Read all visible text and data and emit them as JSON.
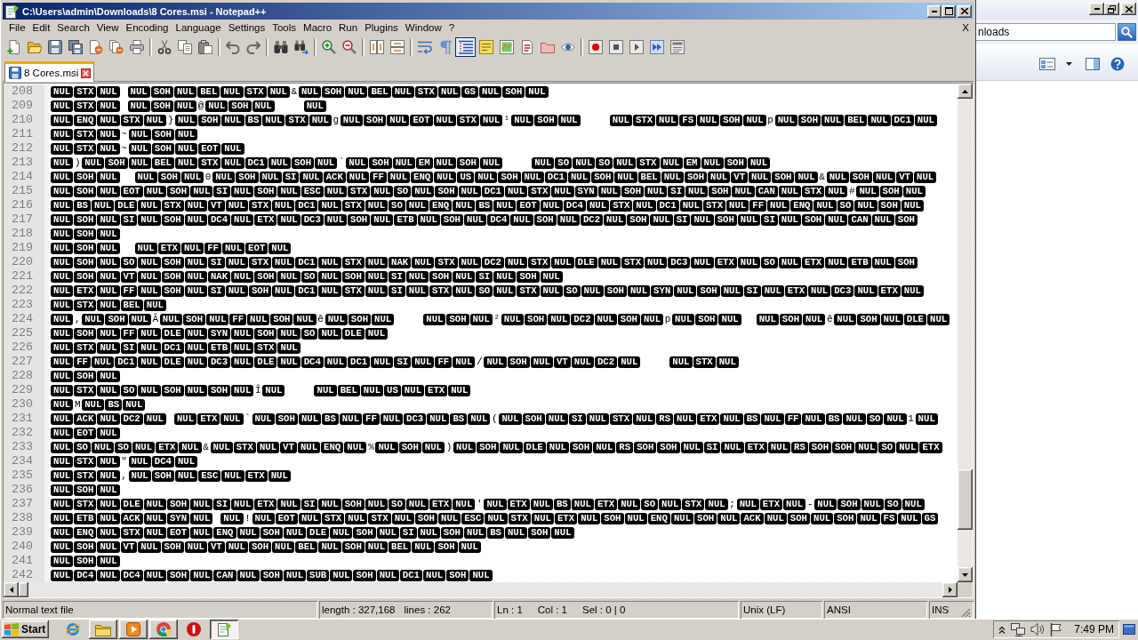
{
  "window": {
    "title": "C:\\Users\\admin\\Downloads\\8 Cores.msi - Notepad++"
  },
  "menu": {
    "items": [
      "File",
      "Edit",
      "Search",
      "View",
      "Encoding",
      "Language",
      "Settings",
      "Tools",
      "Macro",
      "Run",
      "Plugins",
      "Window",
      "?"
    ],
    "close_button": "X"
  },
  "toolbar": [
    {
      "selected": false
    },
    {
      "selected": false
    },
    {
      "selected": false
    },
    {
      "selected": false
    },
    {
      "selected": false
    },
    {
      "selected": false
    },
    {
      "selected": false
    },
    {
      "selected": false
    },
    {
      "selected": false
    },
    {
      "selected": false
    },
    {
      "selected": false
    },
    {
      "selected": false
    },
    {
      "selected": false
    },
    {
      "selected": false
    },
    {
      "selected": false
    },
    {
      "selected": false
    },
    {
      "selected": false
    },
    {
      "selected": false
    },
    {
      "selected": false
    },
    {
      "selected": false
    },
    {
      "selected": true
    },
    {
      "selected": false
    },
    {
      "selected": false
    },
    {
      "selected": false
    },
    {
      "selected": false
    },
    {
      "selected": false
    },
    {
      "selected": false
    },
    {
      "selected": false
    },
    {
      "selected": false
    },
    {
      "selected": false
    },
    {
      "selected": false
    }
  ],
  "tabs": [
    {
      "label": "8 Cores.msi",
      "selected": true
    }
  ],
  "editor": {
    "lines": [
      {
        "number": "208",
        "runs": [
          {
            "kind": "ctrl",
            "codes": [
              "NUL",
              "STX",
              "NUL"
            ]
          },
          {
            "kind": "space"
          },
          {
            "kind": "ctrl",
            "codes": [
              "NUL",
              "SOH",
              "NUL",
              "BEL",
              "NUL",
              "STX",
              "NUL"
            ]
          },
          {
            "kind": "text",
            "text": "&"
          },
          {
            "kind": "ctrl",
            "codes": [
              "NUL",
              "SOH",
              "NUL",
              "BEL",
              "NUL",
              "STX",
              "NUL",
              "GS",
              "NUL",
              "SOH",
              "NUL"
            ]
          }
        ]
      },
      {
        "number": "209",
        "runs": [
          {
            "kind": "ctrl",
            "codes": [
              "NUL",
              "STX",
              "NUL"
            ]
          },
          {
            "kind": "space"
          },
          {
            "kind": "ctrl",
            "codes": [
              "NUL",
              "SOH",
              "NUL"
            ]
          },
          {
            "kind": "text",
            "text": "@"
          },
          {
            "kind": "ctrl",
            "codes": [
              "NUL",
              "SOH",
              "NUL"
            ]
          },
          {
            "kind": "tab"
          },
          {
            "kind": "ctrl",
            "codes": [
              "NUL"
            ]
          }
        ]
      },
      {
        "number": "210",
        "runs": [
          {
            "kind": "ctrl",
            "codes": [
              "NUL",
              "ENQ",
              "NUL",
              "STX",
              "NUL"
            ]
          },
          {
            "kind": "text",
            "text": "}"
          },
          {
            "kind": "ctrl",
            "codes": [
              "NUL",
              "SOH",
              "NUL",
              "BS",
              "NUL",
              "STX",
              "NUL"
            ]
          },
          {
            "kind": "text",
            "text": "g"
          },
          {
            "kind": "ctrl",
            "codes": [
              "NUL",
              "SOH",
              "NUL",
              "EOT",
              "NUL",
              "STX",
              "NUL"
            ]
          },
          {
            "kind": "text",
            "text": "¹"
          },
          {
            "kind": "ctrl",
            "codes": [
              "NUL",
              "SOH",
              "NUL"
            ]
          },
          {
            "kind": "tab"
          },
          {
            "kind": "ctrl",
            "codes": [
              "NUL",
              "STX",
              "NUL",
              "FS",
              "NUL",
              "SOH",
              "NUL"
            ]
          },
          {
            "kind": "text",
            "text": "p"
          },
          {
            "kind": "ctrl",
            "codes": [
              "NUL",
              "SOH",
              "NUL",
              "BEL",
              "NUL",
              "DC1",
              "NUL"
            ]
          }
        ]
      },
      {
        "number": "211",
        "runs": [
          {
            "kind": "ctrl",
            "codes": [
              "NUL",
              "STX",
              "NUL"
            ]
          },
          {
            "kind": "text",
            "text": "~"
          },
          {
            "kind": "ctrl",
            "codes": [
              "NUL",
              "SOH",
              "NUL"
            ]
          }
        ]
      },
      {
        "number": "212",
        "runs": [
          {
            "kind": "ctrl",
            "codes": [
              "NUL",
              "STX",
              "NUL"
            ]
          },
          {
            "kind": "text",
            "text": "~"
          },
          {
            "kind": "ctrl",
            "codes": [
              "NUL",
              "SOH",
              "NUL",
              "EOT",
              "NUL"
            ]
          }
        ]
      },
      {
        "number": "213",
        "runs": [
          {
            "kind": "ctrl",
            "codes": [
              "NUL"
            ]
          },
          {
            "kind": "text",
            "text": ")"
          },
          {
            "kind": "ctrl",
            "codes": [
              "NUL",
              "SOH",
              "NUL",
              "BEL",
              "NUL",
              "STX",
              "NUL",
              "DC1",
              "NUL",
              "SOH",
              "NUL"
            ]
          },
          {
            "kind": "text",
            "text": "`"
          },
          {
            "kind": "ctrl",
            "codes": [
              "NUL",
              "SOH",
              "NUL",
              "EM",
              "NUL",
              "SOH",
              "NUL"
            ]
          },
          {
            "kind": "tab"
          },
          {
            "kind": "ctrl",
            "codes": [
              "NUL",
              "SO",
              "NUL",
              "SO",
              "NUL",
              "STX",
              "NUL",
              "EM",
              "NUL",
              "SOH",
              "NUL"
            ]
          }
        ]
      },
      {
        "number": "214",
        "runs": [
          {
            "kind": "ctrl",
            "codes": [
              "NUL",
              "SOH",
              "NUL"
            ]
          },
          {
            "kind": "space"
          },
          {
            "kind": "space"
          },
          {
            "kind": "ctrl",
            "codes": [
              "NUL",
              "SOH",
              "NUL"
            ]
          },
          {
            "kind": "text",
            "text": "0"
          },
          {
            "kind": "ctrl",
            "codes": [
              "NUL",
              "SOH",
              "NUL",
              "SI",
              "NUL",
              "ACK",
              "NUL",
              "FF",
              "NUL",
              "ENQ",
              "NUL",
              "US",
              "NUL",
              "SOH",
              "NUL",
              "DC1",
              "NUL",
              "SOH",
              "NUL",
              "BEL",
              "NUL",
              "SOH",
              "NUL",
              "VT",
              "NUL",
              "SOH",
              "NUL"
            ]
          },
          {
            "kind": "text",
            "text": "&"
          },
          {
            "kind": "ctrl",
            "codes": [
              "NUL",
              "SOH",
              "NUL",
              "VT",
              "NUL"
            ]
          }
        ]
      },
      {
        "number": "215",
        "runs": [
          {
            "kind": "ctrl",
            "codes": [
              "NUL",
              "SOH",
              "NUL",
              "EOT",
              "NUL",
              "SOH",
              "NUL",
              "SI",
              "NUL",
              "SOH",
              "NUL",
              "ESC",
              "NUL",
              "STX",
              "NUL",
              "SO",
              "NUL",
              "SOH",
              "NUL",
              "DC1",
              "NUL",
              "STX",
              "NUL",
              "SYN",
              "NUL",
              "SOH",
              "NUL",
              "SI",
              "NUL",
              "SOH",
              "NUL",
              "CAN",
              "NUL",
              "STX",
              "NUL"
            ]
          },
          {
            "kind": "text",
            "text": "#"
          },
          {
            "kind": "ctrl",
            "codes": [
              "NUL",
              "SOH",
              "NUL"
            ]
          }
        ]
      },
      {
        "number": "216",
        "runs": [
          {
            "kind": "ctrl",
            "codes": [
              "NUL",
              "BS",
              "NUL",
              "DLE",
              "NUL",
              "STX",
              "NUL",
              "VT",
              "NUL",
              "STX",
              "NUL",
              "DC1",
              "NUL",
              "STX",
              "NUL",
              "SO",
              "NUL",
              "ENQ",
              "NUL",
              "BS",
              "NUL",
              "EOT",
              "NUL",
              "DC4",
              "NUL",
              "STX",
              "NUL",
              "DC1",
              "NUL",
              "STX",
              "NUL",
              "FF",
              "NUL",
              "ENQ",
              "NUL",
              "SO",
              "NUL",
              "SOH",
              "NUL"
            ]
          }
        ]
      },
      {
        "number": "217",
        "runs": [
          {
            "kind": "ctrl",
            "codes": [
              "NUL",
              "SOH",
              "NUL",
              "SI",
              "NUL",
              "SOH",
              "NUL",
              "DC4",
              "NUL",
              "ETX",
              "NUL",
              "DC3",
              "NUL",
              "SOH",
              "NUL",
              "ETB",
              "NUL",
              "SOH",
              "NUL",
              "DC4",
              "NUL",
              "SOH",
              "NUL",
              "DC2",
              "NUL",
              "SOH",
              "NUL",
              "SI",
              "NUL",
              "SOH",
              "NUL",
              "SI",
              "NUL",
              "SOH",
              "NUL",
              "CAN",
              "NUL",
              "SOH"
            ]
          }
        ]
      },
      {
        "number": "218",
        "runs": [
          {
            "kind": "ctrl",
            "codes": [
              "NUL",
              "SOH",
              "NUL"
            ]
          }
        ]
      },
      {
        "number": "219",
        "runs": [
          {
            "kind": "ctrl",
            "codes": [
              "NUL",
              "SOH",
              "NUL"
            ]
          },
          {
            "kind": "space"
          },
          {
            "kind": "space"
          },
          {
            "kind": "ctrl",
            "codes": [
              "NUL",
              "ETX",
              "NUL",
              "FF",
              "NUL",
              "EOT",
              "NUL"
            ]
          }
        ]
      },
      {
        "number": "220",
        "runs": [
          {
            "kind": "ctrl",
            "codes": [
              "NUL",
              "SOH",
              "NUL",
              "SO",
              "NUL",
              "SOH",
              "NUL",
              "SI",
              "NUL",
              "STX",
              "NUL",
              "DC1",
              "NUL",
              "STX",
              "NUL",
              "NAK",
              "NUL",
              "STX",
              "NUL",
              "DC2",
              "NUL",
              "STX",
              "NUL",
              "DLE",
              "NUL",
              "STX",
              "NUL",
              "DC3",
              "NUL",
              "ETX",
              "NUL",
              "SO",
              "NUL",
              "ETX",
              "NUL",
              "ETB",
              "NUL",
              "SOH"
            ]
          }
        ]
      },
      {
        "number": "221",
        "runs": [
          {
            "kind": "ctrl",
            "codes": [
              "NUL",
              "SOH",
              "NUL",
              "VT",
              "NUL",
              "SOH",
              "NUL",
              "NAK",
              "NUL",
              "SOH",
              "NUL",
              "SO",
              "NUL",
              "SOH",
              "NUL",
              "SI",
              "NUL",
              "SOH",
              "NUL",
              "SI",
              "NUL",
              "SOH",
              "NUL"
            ]
          }
        ]
      },
      {
        "number": "222",
        "runs": [
          {
            "kind": "ctrl",
            "codes": [
              "NUL",
              "ETX",
              "NUL",
              "FF",
              "NUL",
              "SOH",
              "NUL",
              "SI",
              "NUL",
              "SOH",
              "NUL",
              "DC1",
              "NUL",
              "STX",
              "NUL",
              "SI",
              "NUL",
              "STX",
              "NUL",
              "SO",
              "NUL",
              "STX",
              "NUL",
              "SO",
              "NUL",
              "SOH",
              "NUL",
              "SYN",
              "NUL",
              "SOH",
              "NUL",
              "SI",
              "NUL",
              "ETX",
              "NUL",
              "DC3",
              "NUL",
              "ETX",
              "NUL"
            ]
          }
        ]
      },
      {
        "number": "223",
        "runs": [
          {
            "kind": "ctrl",
            "codes": [
              "NUL",
              "STX",
              "NUL",
              "BEL",
              "NUL"
            ]
          }
        ]
      },
      {
        "number": "224",
        "runs": [
          {
            "kind": "ctrl",
            "codes": [
              "NUL"
            ]
          },
          {
            "kind": "text",
            "text": ","
          },
          {
            "kind": "ctrl",
            "codes": [
              "NUL",
              "SOH",
              "NUL"
            ]
          },
          {
            "kind": "text",
            "text": "Â"
          },
          {
            "kind": "ctrl",
            "codes": [
              "NUL",
              "SOH",
              "NUL",
              "FF",
              "NUL",
              "SOH",
              "NUL"
            ]
          },
          {
            "kind": "text",
            "text": "ê"
          },
          {
            "kind": "ctrl",
            "codes": [
              "NUL",
              "SOH",
              "NUL"
            ]
          },
          {
            "kind": "tab"
          },
          {
            "kind": "ctrl",
            "codes": [
              "NUL",
              "SOH",
              "NUL"
            ]
          },
          {
            "kind": "text",
            "text": "²"
          },
          {
            "kind": "ctrl",
            "codes": [
              "NUL",
              "SOH",
              "NUL",
              "DC2",
              "NUL",
              "SOH",
              "NUL"
            ]
          },
          {
            "kind": "text",
            "text": "p"
          },
          {
            "kind": "ctrl",
            "codes": [
              "NUL",
              "SOH",
              "NUL"
            ]
          },
          {
            "kind": "space"
          },
          {
            "kind": "space"
          },
          {
            "kind": "ctrl",
            "codes": [
              "NUL",
              "SOH",
              "NUL"
            ]
          },
          {
            "kind": "text",
            "text": "ê"
          },
          {
            "kind": "ctrl",
            "codes": [
              "NUL",
              "SOH",
              "NUL",
              "DLE",
              "NUL"
            ]
          }
        ]
      },
      {
        "number": "225",
        "runs": [
          {
            "kind": "ctrl",
            "codes": [
              "NUL",
              "SOH",
              "NUL",
              "FF",
              "NUL",
              "DLE",
              "NUL",
              "SYN",
              "NUL",
              "SOH",
              "NUL",
              "SO",
              "NUL",
              "DLE",
              "NUL"
            ]
          }
        ]
      },
      {
        "number": "226",
        "runs": [
          {
            "kind": "ctrl",
            "codes": [
              "NUL",
              "STX",
              "NUL",
              "SI",
              "NUL",
              "DC1",
              "NUL",
              "ETB",
              "NUL",
              "STX",
              "NUL"
            ]
          }
        ]
      },
      {
        "number": "227",
        "runs": [
          {
            "kind": "ctrl",
            "codes": [
              "NUL",
              "FF",
              "NUL",
              "DC1",
              "NUL",
              "DLE",
              "NUL",
              "DC3",
              "NUL",
              "DLE",
              "NUL",
              "DC4",
              "NUL",
              "DC1",
              "NUL",
              "SI",
              "NUL",
              "FF",
              "NUL"
            ]
          },
          {
            "kind": "text",
            "text": "/"
          },
          {
            "kind": "ctrl",
            "codes": [
              "NUL",
              "SOH",
              "NUL",
              "VT",
              "NUL",
              "DC2",
              "NUL"
            ]
          },
          {
            "kind": "tab"
          },
          {
            "kind": "ctrl",
            "codes": [
              "NUL",
              "STX",
              "NUL"
            ]
          }
        ]
      },
      {
        "number": "228",
        "runs": [
          {
            "kind": "ctrl",
            "codes": [
              "NUL",
              "SOH",
              "NUL"
            ]
          }
        ]
      },
      {
        "number": "229",
        "runs": [
          {
            "kind": "ctrl",
            "codes": [
              "NUL",
              "STX",
              "NUL",
              "SO",
              "NUL",
              "SOH",
              "NUL",
              "SOH",
              "NUL"
            ]
          },
          {
            "kind": "text",
            "text": "Î"
          },
          {
            "kind": "ctrl",
            "codes": [
              "NUL"
            ]
          },
          {
            "kind": "tab"
          },
          {
            "kind": "ctrl",
            "codes": [
              "NUL",
              "BEL",
              "NUL",
              "US",
              "NUL",
              "ETX",
              "NUL"
            ]
          }
        ]
      },
      {
        "number": "230",
        "runs": [
          {
            "kind": "ctrl",
            "codes": [
              "NUL"
            ]
          },
          {
            "kind": "text",
            "text": "M"
          },
          {
            "kind": "ctrl",
            "codes": [
              "NUL",
              "BS",
              "NUL"
            ]
          }
        ]
      },
      {
        "number": "231",
        "runs": [
          {
            "kind": "ctrl",
            "codes": [
              "NUL",
              "ACK",
              "NUL",
              "DC2",
              "NUL"
            ]
          },
          {
            "kind": "space"
          },
          {
            "kind": "ctrl",
            "codes": [
              "NUL",
              "ETX",
              "NUL"
            ]
          },
          {
            "kind": "text",
            "text": "`"
          },
          {
            "kind": "ctrl",
            "codes": [
              "NUL",
              "SOH",
              "NUL",
              "BS",
              "NUL",
              "FF",
              "NUL",
              "DC3",
              "NUL",
              "BS",
              "NUL"
            ]
          },
          {
            "kind": "text",
            "text": "("
          },
          {
            "kind": "ctrl",
            "codes": [
              "NUL",
              "SOH",
              "NUL",
              "SI",
              "NUL",
              "STX",
              "NUL",
              "RS",
              "NUL",
              "ETX",
              "NUL",
              "BS",
              "NUL",
              "FF",
              "NUL",
              "BS",
              "NUL",
              "SO",
              "NUL"
            ]
          },
          {
            "kind": "text",
            "text": "1"
          },
          {
            "kind": "ctrl",
            "codes": [
              "NUL"
            ]
          }
        ]
      },
      {
        "number": "232",
        "runs": [
          {
            "kind": "ctrl",
            "codes": [
              "NUL",
              "EOT",
              "NUL"
            ]
          }
        ]
      },
      {
        "number": "233",
        "runs": [
          {
            "kind": "ctrl",
            "codes": [
              "NUL",
              "SO",
              "NUL",
              "SO",
              "NUL",
              "ETX",
              "NUL"
            ]
          },
          {
            "kind": "text",
            "text": "&"
          },
          {
            "kind": "ctrl",
            "codes": [
              "NUL",
              "STX",
              "NUL",
              "VT",
              "NUL",
              "ENQ",
              "NUL"
            ]
          },
          {
            "kind": "text",
            "text": "%"
          },
          {
            "kind": "ctrl",
            "codes": [
              "NUL",
              "SOH",
              "NUL"
            ]
          },
          {
            "kind": "text",
            "text": ")"
          },
          {
            "kind": "ctrl",
            "codes": [
              "NUL",
              "SOH",
              "NUL",
              "DLE",
              "NUL",
              "SOH",
              "NUL",
              "RS",
              "SOH",
              "SOH",
              "NUL",
              "SI",
              "NUL",
              "ETX",
              "NUL",
              "RS",
              "SOH",
              "SOH",
              "NUL",
              "SO",
              "NUL",
              "ETX"
            ]
          }
        ]
      },
      {
        "number": "234",
        "runs": [
          {
            "kind": "ctrl",
            "codes": [
              "NUL",
              "STX",
              "NUL"
            ]
          },
          {
            "kind": "text",
            "text": "\""
          },
          {
            "kind": "ctrl",
            "codes": [
              "NUL",
              "DC4",
              "NUL"
            ]
          }
        ]
      },
      {
        "number": "235",
        "runs": [
          {
            "kind": "ctrl",
            "codes": [
              "NUL",
              "STX",
              "NUL"
            ]
          },
          {
            "kind": "text",
            "text": ","
          },
          {
            "kind": "ctrl",
            "codes": [
              "NUL",
              "SOH",
              "NUL",
              "ESC",
              "NUL",
              "ETX",
              "NUL"
            ]
          }
        ]
      },
      {
        "number": "236",
        "runs": [
          {
            "kind": "ctrl",
            "codes": [
              "NUL",
              "SOH",
              "NUL"
            ]
          }
        ]
      },
      {
        "number": "237",
        "runs": [
          {
            "kind": "ctrl",
            "codes": [
              "NUL",
              "STX",
              "NUL",
              "DLE",
              "NUL",
              "SOH",
              "NUL",
              "SI",
              "NUL",
              "ETX",
              "NUL",
              "SI",
              "NUL",
              "SOH",
              "NUL",
              "SO",
              "NUL",
              "ETX",
              "NUL"
            ]
          },
          {
            "kind": "text",
            "text": "'"
          },
          {
            "kind": "ctrl",
            "codes": [
              "NUL",
              "ETX",
              "NUL",
              "BS",
              "NUL",
              "ETX",
              "NUL",
              "SO",
              "NUL",
              "STX",
              "NUL"
            ]
          },
          {
            "kind": "text",
            "text": ";"
          },
          {
            "kind": "ctrl",
            "codes": [
              "NUL",
              "ETX",
              "NUL"
            ]
          },
          {
            "kind": "text",
            "text": "-"
          },
          {
            "kind": "ctrl",
            "codes": [
              "NUL",
              "SOH",
              "NUL",
              "SO",
              "NUL"
            ]
          }
        ]
      },
      {
        "number": "238",
        "runs": [
          {
            "kind": "ctrl",
            "codes": [
              "NUL",
              "ETB",
              "NUL",
              "ACK",
              "NUL",
              "SYN",
              "NUL"
            ]
          },
          {
            "kind": "space"
          },
          {
            "kind": "ctrl",
            "codes": [
              "NUL"
            ]
          },
          {
            "kind": "text",
            "text": "!"
          },
          {
            "kind": "ctrl",
            "codes": [
              "NUL",
              "EOT",
              "NUL",
              "STX",
              "NUL",
              "STX",
              "NUL",
              "SOH",
              "NUL",
              "ESC",
              "NUL",
              "STX",
              "NUL",
              "ETX",
              "NUL",
              "SOH",
              "NUL",
              "ENQ",
              "NUL",
              "SOH",
              "NUL",
              "ACK",
              "NUL",
              "SOH",
              "NUL",
              "SOH",
              "NUL",
              "FS",
              "NUL",
              "GS"
            ]
          }
        ]
      },
      {
        "number": "239",
        "runs": [
          {
            "kind": "ctrl",
            "codes": [
              "NUL",
              "ENQ",
              "NUL",
              "STX",
              "NUL",
              "EOT",
              "NUL",
              "ENQ",
              "NUL",
              "SOH",
              "NUL",
              "DLE",
              "NUL",
              "SOH",
              "NUL",
              "SI",
              "NUL",
              "SOH",
              "NUL",
              "BS",
              "NUL",
              "SOH",
              "NUL"
            ]
          }
        ]
      },
      {
        "number": "240",
        "runs": [
          {
            "kind": "ctrl",
            "codes": [
              "NUL",
              "SOH",
              "NUL",
              "VT",
              "NUL",
              "SOH",
              "NUL",
              "VT",
              "NUL",
              "SOH",
              "NUL",
              "BEL",
              "NUL",
              "SOH",
              "NUL",
              "BEL",
              "NUL",
              "SOH",
              "NUL"
            ]
          }
        ]
      },
      {
        "number": "241",
        "runs": [
          {
            "kind": "ctrl",
            "codes": [
              "NUL",
              "SOH",
              "NUL"
            ]
          }
        ]
      },
      {
        "number": "242",
        "runs": [
          {
            "kind": "ctrl",
            "codes": [
              "NUL",
              "DC4",
              "NUL",
              "DC4",
              "NUL",
              "SOH",
              "NUL",
              "CAN",
              "NUL",
              "SOH",
              "NUL",
              "SUB",
              "NUL",
              "SOH",
              "NUL",
              "DC1",
              "NUL",
              "SOH",
              "NUL"
            ]
          }
        ]
      }
    ]
  },
  "status_bar": [
    {
      "texts": [
        "Normal text file"
      ]
    },
    {
      "texts": [
        "length : 327,168",
        "lines : 262"
      ]
    },
    {
      "texts": [
        "Ln : 1",
        "Col : 1",
        "Sel : 0 | 0"
      ]
    },
    {
      "texts": [
        "Unix (LF)"
      ]
    },
    {
      "texts": [
        "ANSI"
      ]
    },
    {
      "texts": [
        "INS"
      ]
    }
  ],
  "background_window": {
    "address": "nloads"
  },
  "taskbar": {
    "start": "Start",
    "apps": [
      {
        "selected": false
      },
      {
        "selected": false
      },
      {
        "selected": false
      },
      {
        "selected": false
      },
      {
        "selected": false
      },
      {
        "selected": true
      }
    ],
    "clock": "7:49 PM"
  }
}
